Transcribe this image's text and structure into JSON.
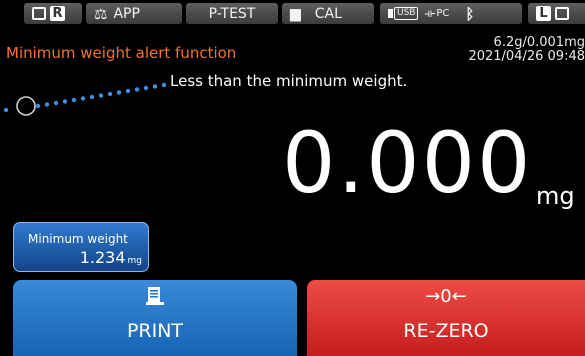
{
  "statusbar": {
    "r_label": "R",
    "app_label": "APP",
    "ptest_label": "P-TEST",
    "cal_label": "CAL",
    "usb_label": "USB",
    "pc_label": "PC",
    "l_label": "L"
  },
  "alert": {
    "title": "Minimum weight alert function",
    "callout": "Less than the minimum weight."
  },
  "capacity": {
    "ratio": "6.2g/0.001mg",
    "datetime": "2021/04/26 09:48"
  },
  "reading": {
    "value": "0.000",
    "unit": "mg"
  },
  "min_weight": {
    "label": "Minimum weight",
    "value": "1.234",
    "unit": "mg"
  },
  "buttons": {
    "print_label": "PRINT",
    "rezero_icon": "→0←",
    "rezero_label": "RE-ZERO"
  },
  "colors": {
    "title_orange": "#f2742a",
    "print_blue": "#1f6fc4",
    "rezero_red": "#d9302c",
    "callout_dots": "#3d8fe0"
  },
  "icons": [
    "balance-icon",
    "calibration-weight-icon",
    "usb-icon",
    "pc-connection-icon",
    "bluetooth-icon",
    "printer-icon"
  ]
}
